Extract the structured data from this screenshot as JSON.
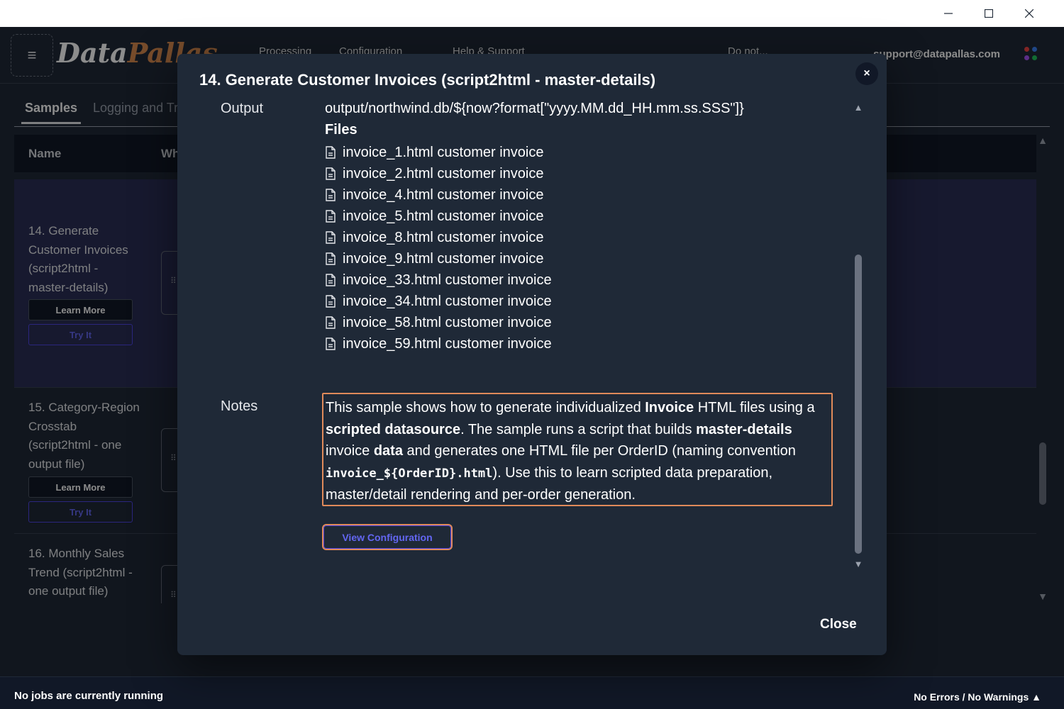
{
  "window": {
    "minimize_icon": "minimize-icon",
    "maximize_icon": "maximize-icon",
    "close_icon": "close-icon"
  },
  "header": {
    "logo_part1": "Data",
    "logo_part2": "Pallas",
    "menu_icon": "hamburger-icon",
    "nav_items": [
      "Processing",
      "Configuration",
      "Help & Support"
    ],
    "nav_right": "Do not...",
    "email": "support@datapallas.com",
    "apps_colors": [
      "#ef4444",
      "#3b82f6",
      "#a855f7",
      "#22c55e"
    ]
  },
  "tabs": {
    "samples": "Samples",
    "logging": "Logging and Tr"
  },
  "table": {
    "col_name": "Name",
    "col_what": "Wh",
    "rows": [
      {
        "title": "14. Generate Customer Invoices (script2html - master-details)",
        "learn": "Learn More",
        "try": "Try It"
      },
      {
        "title": "15. Category-Region Crosstab (script2html - one output file)",
        "learn": "Learn More",
        "try": "Try It"
      },
      {
        "title": "16. Monthly Sales Trend (script2html - one output file)"
      }
    ]
  },
  "status": {
    "left": "No jobs are currently running",
    "right": "No Errors / No Warnings ▲"
  },
  "modal": {
    "title": "14. Generate Customer Invoices (script2html - master-details)",
    "close_x": "×",
    "output_label": "Output",
    "output_path": "output/northwind.db/${now?format[\"yyyy.MM.dd_HH.mm.ss.SSS\"]}",
    "files_title": "Files",
    "files": [
      "invoice_1.html customer invoice",
      "invoice_2.html customer invoice",
      "invoice_4.html customer invoice",
      "invoice_5.html customer invoice",
      "invoice_8.html customer invoice",
      "invoice_9.html customer invoice",
      "invoice_33.html customer invoice",
      "invoice_34.html customer invoice",
      "invoice_58.html customer invoice",
      "invoice_59.html customer invoice"
    ],
    "notes_label": "Notes",
    "notes": {
      "t1": "This sample shows how to generate individualized ",
      "b1": "Invoice",
      "t2": " HTML files using a ",
      "b2": "scripted datasource",
      "t3": ". The sample runs a script that builds ",
      "b3": "master-details",
      "t4": " invoice ",
      "b4": "data",
      "t5": " and generates one HTML file per OrderID (naming convention ",
      "code": "invoice_${OrderID}.html",
      "t6": "). Use this to learn scripted data preparation, master/detail rendering and per-order generation."
    },
    "view_config": "View Configuration",
    "close": "Close"
  }
}
